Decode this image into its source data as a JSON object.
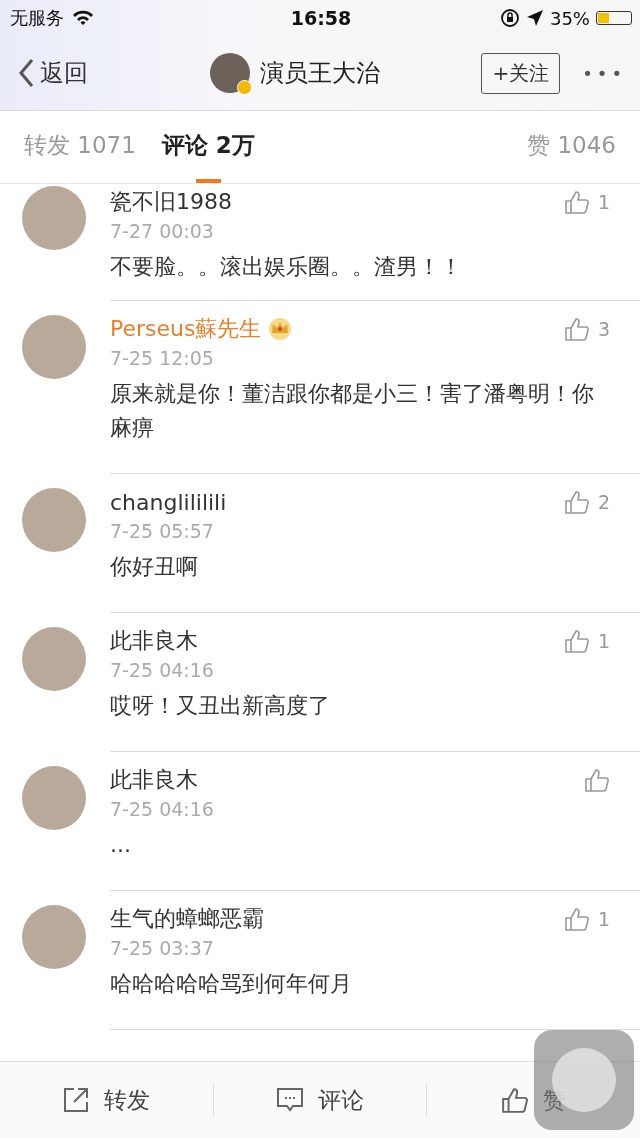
{
  "status_bar": {
    "carrier": "无服务",
    "time": "16:58",
    "battery": "35%"
  },
  "nav": {
    "back": "返回",
    "title": "演员王大治",
    "verified": true,
    "follow": "+关注",
    "more": "•••"
  },
  "tabs": [
    {
      "label": "转发 1071",
      "selected": false
    },
    {
      "label": "评论 2万",
      "selected": true
    },
    {
      "label": "赞 1046",
      "selected": false
    }
  ],
  "comments": [
    {
      "user": "瓷不旧1988",
      "vip": false,
      "time": "7-27 00:03",
      "text": "不要脸。。滚出娱乐圈。。渣男！！",
      "likes": "1"
    },
    {
      "user": "Perseus蘇先生",
      "vip": true,
      "time": "7-25 12:05",
      "text": "原来就是你！董洁跟你都是小三！害了潘粤明！你麻痹",
      "likes": "3"
    },
    {
      "user": "changlililili",
      "vip": false,
      "time": "7-25 05:57",
      "text": "你好丑啊",
      "likes": "2"
    },
    {
      "user": "此非良木",
      "vip": false,
      "time": "7-25 04:16",
      "text": "哎呀！又丑出新高度了",
      "likes": "1"
    },
    {
      "user": "此非良木",
      "vip": false,
      "time": "7-25 04:16",
      "text": "..."
    },
    {
      "user": "生气的蟑螂恶霸",
      "vip": false,
      "time": "7-25 03:37",
      "text": "哈哈哈哈哈骂到何年何月",
      "likes": "1"
    }
  ],
  "toolbar": [
    {
      "kind": "repost",
      "label": "转发"
    },
    {
      "kind": "comment",
      "label": "评论"
    },
    {
      "kind": "like",
      "label": "赞"
    }
  ]
}
